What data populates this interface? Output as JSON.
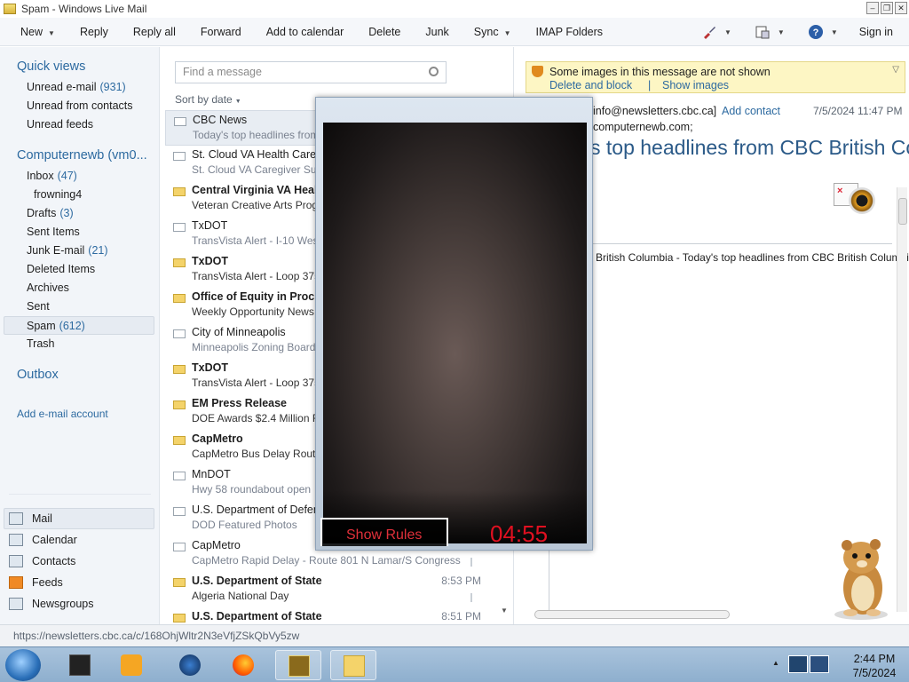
{
  "window": {
    "title": "Spam - Windows Live Mail"
  },
  "toolbar": {
    "new": "New",
    "reply": "Reply",
    "reply_all": "Reply all",
    "forward": "Forward",
    "add_to_calendar": "Add to calendar",
    "delete": "Delete",
    "junk": "Junk",
    "sync": "Sync",
    "imap_folders": "IMAP Folders",
    "sign_in": "Sign in"
  },
  "sidebar": {
    "quick_views_heading": "Quick views",
    "quick_views": [
      {
        "label": "Unread e-mail",
        "count": "(931)"
      },
      {
        "label": "Unread from contacts"
      },
      {
        "label": "Unread feeds"
      }
    ],
    "account_heading": "Computernewb (vm0...",
    "folders": [
      {
        "label": "Inbox",
        "count": "(47)"
      },
      {
        "label": "frowning4"
      },
      {
        "label": "Drafts",
        "count": "(3)"
      },
      {
        "label": "Sent Items"
      },
      {
        "label": "Junk E-mail",
        "count": "(21)"
      },
      {
        "label": "Deleted Items"
      },
      {
        "label": "Archives"
      },
      {
        "label": "Sent"
      },
      {
        "label": "Spam",
        "count": "(612)"
      },
      {
        "label": "Trash"
      }
    ],
    "outbox": "Outbox",
    "add_account": "Add e-mail account",
    "nav": [
      "Mail",
      "Calendar",
      "Contacts",
      "Feeds",
      "Newsgroups"
    ]
  },
  "list": {
    "search_placeholder": "Find a message",
    "sort_label": "Sort by date",
    "messages": [
      {
        "from": "CBC News",
        "subject": "Today's top headlines from",
        "time": "",
        "unread": false
      },
      {
        "from": "St. Cloud VA Health Care S",
        "subject": "St. Cloud VA Caregiver Sup",
        "time": "",
        "unread": false
      },
      {
        "from": "Central Virginia VA Healt",
        "subject": "Veteran Creative Arts Prog",
        "time": "",
        "unread": true
      },
      {
        "from": "TxDOT",
        "subject": "TransVista Alert - I-10 Wes",
        "time": "",
        "unread": false
      },
      {
        "from": "TxDOT",
        "subject": "TransVista Alert - Loop 375",
        "time": "",
        "unread": true
      },
      {
        "from": "Office of Equity in Procur",
        "subject": "Weekly Opportunity News",
        "time": "",
        "unread": true
      },
      {
        "from": "City of Minneapolis",
        "subject": "Minneapolis Zoning Board",
        "time": "",
        "unread": false
      },
      {
        "from": "TxDOT",
        "subject": "TransVista Alert - Loop 375",
        "time": "",
        "unread": true
      },
      {
        "from": "EM Press Release",
        "subject": "DOE Awards $2.4 Million F",
        "time": "",
        "unread": true
      },
      {
        "from": "CapMetro",
        "subject": "CapMetro Bus Delay Route",
        "time": "",
        "unread": true
      },
      {
        "from": "MnDOT",
        "subject": "Hwy 58 roundabout open",
        "time": "",
        "unread": false
      },
      {
        "from": "U.S. Department of Defens",
        "subject": "DOD Featured Photos",
        "time": "",
        "unread": false
      },
      {
        "from": "CapMetro",
        "subject": "CapMetro Rapid Delay - Route 801 N Lamar/S Congress",
        "time": "",
        "unread": false
      },
      {
        "from": "U.S. Department of State",
        "subject": "Algeria National Day",
        "time": "8:53 PM",
        "unread": true
      },
      {
        "from": "U.S. Department of State",
        "subject": "",
        "time": "8:51 PM",
        "unread": true
      }
    ]
  },
  "reading": {
    "images_blocked": "Some images in this message are not shown",
    "delete_and_block": "Delete and block",
    "separator": "|",
    "show_images": "Show images",
    "from_partial": "info@newsletters.cbc.ca]",
    "add_contact": "Add contact",
    "date": "7/5/2024 11:47 PM",
    "to_partial": "computernewb.com;",
    "subject_partial": "s top headlines from CBC British Co",
    "body_partial": "British Columbia - Today's top headlines from CBC British Columbia"
  },
  "popup": {
    "show_rules": "Show Rules",
    "timer": "04:55"
  },
  "status": {
    "url": "https://newsletters.cbc.ca/c/168OhjWltr2N3eVfjZSkQbVy5zw"
  },
  "taskbar": {
    "time": "2:44 PM",
    "date": "7/5/2024"
  }
}
